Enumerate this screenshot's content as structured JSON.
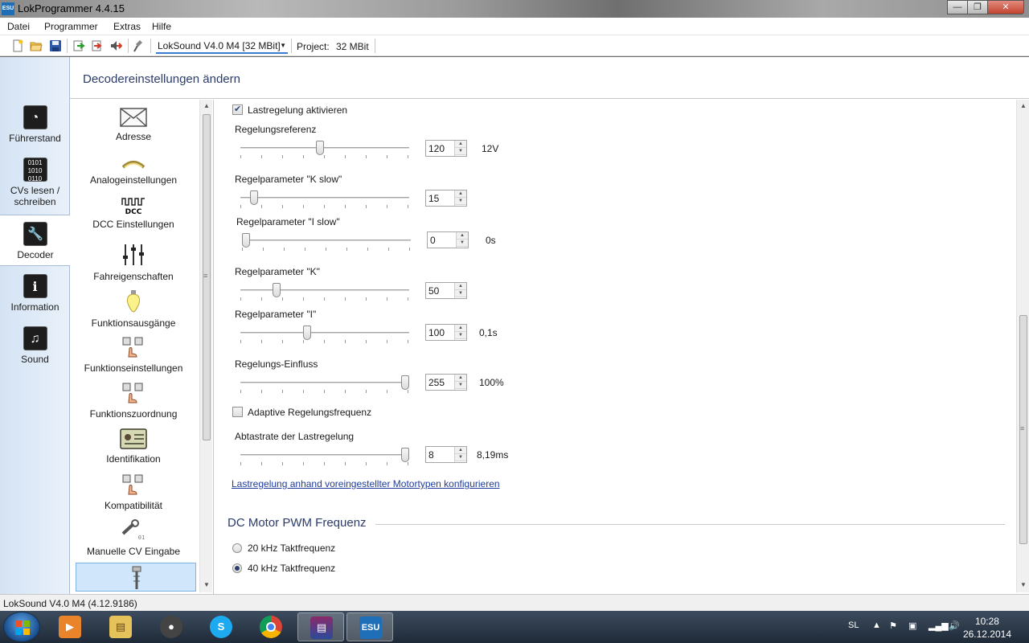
{
  "window": {
    "title": "LokProgrammer 4.4.15",
    "icon_text": "ESU",
    "minimize_icon": "minimize-icon",
    "maximize_icon": "maximize-icon",
    "close_icon": "close-icon"
  },
  "menu": [
    "Datei",
    "Programmer",
    "Extras",
    "Hilfe"
  ],
  "toolbar": {
    "icons": [
      "new-file-icon",
      "open-folder-icon",
      "save-icon",
      "read-decoder-icon",
      "write-decoder-icon",
      "write-sound-icon",
      "settings-tool-icon"
    ],
    "decoder": "LokSound V4.0 M4 [32 MBit]",
    "project_label": "Project:",
    "project_value": "32 MBit"
  },
  "nav": [
    {
      "label": "Führerstand",
      "icon": "gauge-icon"
    },
    {
      "label": "CVs lesen / schreiben",
      "icon": "binary-icon"
    },
    {
      "label": "Decoder",
      "icon": "wrench-icon",
      "active": true
    },
    {
      "label": "Information",
      "icon": "info-icon"
    },
    {
      "label": "Sound",
      "icon": "music-note-icon"
    }
  ],
  "panel_title": "Decodereinstellungen ändern",
  "categories": [
    {
      "label": "Adresse",
      "icon": "envelope-icon"
    },
    {
      "label": "Analogeinstellungen",
      "icon": "analog-icon"
    },
    {
      "label": "DCC Einstellungen",
      "icon": "dcc-icon"
    },
    {
      "label": "Fahreigenschaften",
      "icon": "sliders-icon"
    },
    {
      "label": "Funktionsausgänge",
      "icon": "lightbulb-icon"
    },
    {
      "label": "Funktionseinstellungen",
      "icon": "function-keys-icon"
    },
    {
      "label": "Funktionszuordnung",
      "icon": "function-keys-icon"
    },
    {
      "label": "Identifikation",
      "icon": "id-card-icon"
    },
    {
      "label": "Kompatibilität",
      "icon": "function-keys-icon"
    },
    {
      "label": "Manuelle CV Eingabe",
      "icon": "wrench-cv-icon"
    },
    {
      "label": "",
      "icon": "motor-icon",
      "selected": true
    }
  ],
  "load_control": {
    "enable_label": "Lastregelung aktivieren",
    "enabled": true,
    "params": [
      {
        "label": "Regelungsreferenz",
        "value": "120",
        "unit": "12V",
        "fraction": 0.47
      },
      {
        "label": "Regelparameter \"K slow\"",
        "value": "15",
        "unit": "",
        "fraction": 0.06
      },
      {
        "label": "Regelparameter \"I slow\"",
        "value": "0",
        "unit": "0s",
        "fraction": 0.0
      },
      {
        "label": "Regelparameter \"K\"",
        "value": "50",
        "unit": "",
        "fraction": 0.2
      },
      {
        "label": "Regelparameter \"I\"",
        "value": "100",
        "unit": "0,1s",
        "fraction": 0.39
      },
      {
        "label": "Regelungs-Einfluss",
        "value": "255",
        "unit": "100%",
        "fraction": 1.0
      }
    ],
    "adaptive_label": "Adaptive Regelungsfrequenz",
    "adaptive_checked": false,
    "sample_rate": {
      "label": "Abtastrate der Lastregelung",
      "value": "8",
      "unit": "8,19ms",
      "fraction": 1.0
    },
    "motor_link": "Lastregelung anhand voreingestellter Motortypen konfigurieren"
  },
  "pwm": {
    "title": "DC Motor PWM Frequenz",
    "options": [
      {
        "label": "20 kHz Taktfrequenz",
        "checked": false
      },
      {
        "label": "40 kHz Taktfrequenz",
        "checked": true
      }
    ]
  },
  "status": "LokSound V4.0 M4 (4.12.9186)",
  "taskbar": {
    "apps": [
      "media-player-icon",
      "file-explorer-icon",
      "app-icon",
      "skype-icon",
      "chrome-icon",
      "winrar-icon",
      "lokprogrammer-icon"
    ],
    "esu_label": "ESU",
    "lang": "SL",
    "time": "10:28",
    "date": "26.12.2014"
  }
}
